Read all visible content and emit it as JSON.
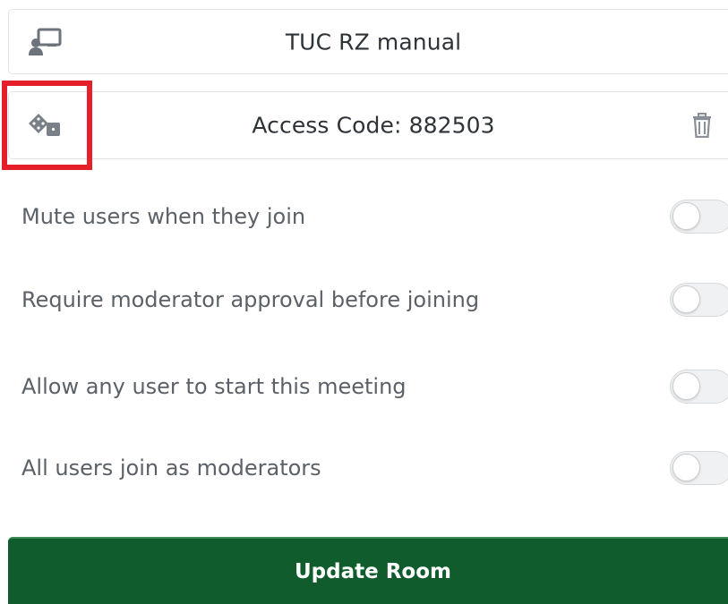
{
  "room": {
    "name": "TUC RZ manual",
    "name_icon": "presentation-user-icon"
  },
  "access_code": {
    "text": "Access Code: 882503",
    "generate_icon": "dice-icon",
    "delete_icon": "trash-icon"
  },
  "settings": [
    {
      "label": "Mute users when they join",
      "enabled": false
    },
    {
      "label": "Require moderator approval before joining",
      "enabled": false
    },
    {
      "label": "Allow any user to start this meeting",
      "enabled": false
    },
    {
      "label": "All users join as moderators",
      "enabled": false
    }
  ],
  "actions": {
    "update_label": "Update Room"
  },
  "colors": {
    "primary_button": "#115c2d",
    "highlight": "#e5202a"
  }
}
